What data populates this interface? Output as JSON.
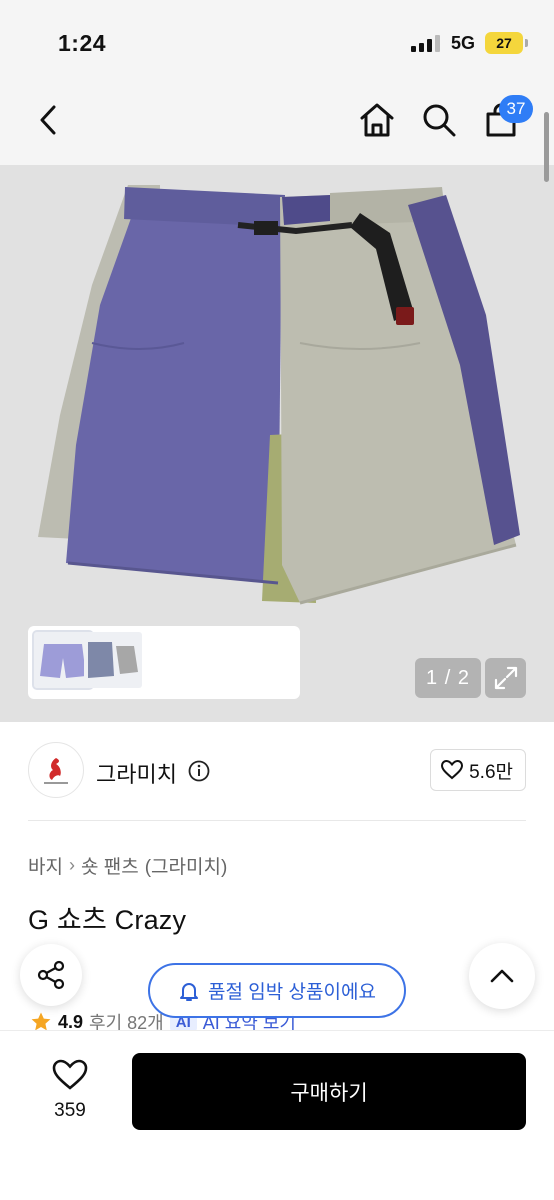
{
  "status_bar": {
    "time": "1:24",
    "network": "5G",
    "battery": "27"
  },
  "nav": {
    "cart_count": "37"
  },
  "gallery": {
    "counter": "1 / 2"
  },
  "brand": {
    "name": "그라미치",
    "likes": "5.6만"
  },
  "breadcrumb": {
    "category": "바지",
    "subcategory": "숏 팬츠",
    "brand_tag": "(그라미치)"
  },
  "product": {
    "title": "G 쇼츠 Crazy",
    "rating": "4.9",
    "reviews": "후기 82개",
    "ai_badge": "AI",
    "ai_summary": "AI 요약 보기"
  },
  "notice": {
    "soldout": "품절 임박 상품이에요"
  },
  "bottom_bar": {
    "wish_count": "359",
    "buy_label": "구매하기"
  },
  "colors": {
    "accent_blue": "#2f7df6",
    "notice_blue": "#3d73e6",
    "buy_button": "#000000",
    "star": "#f5a623"
  }
}
